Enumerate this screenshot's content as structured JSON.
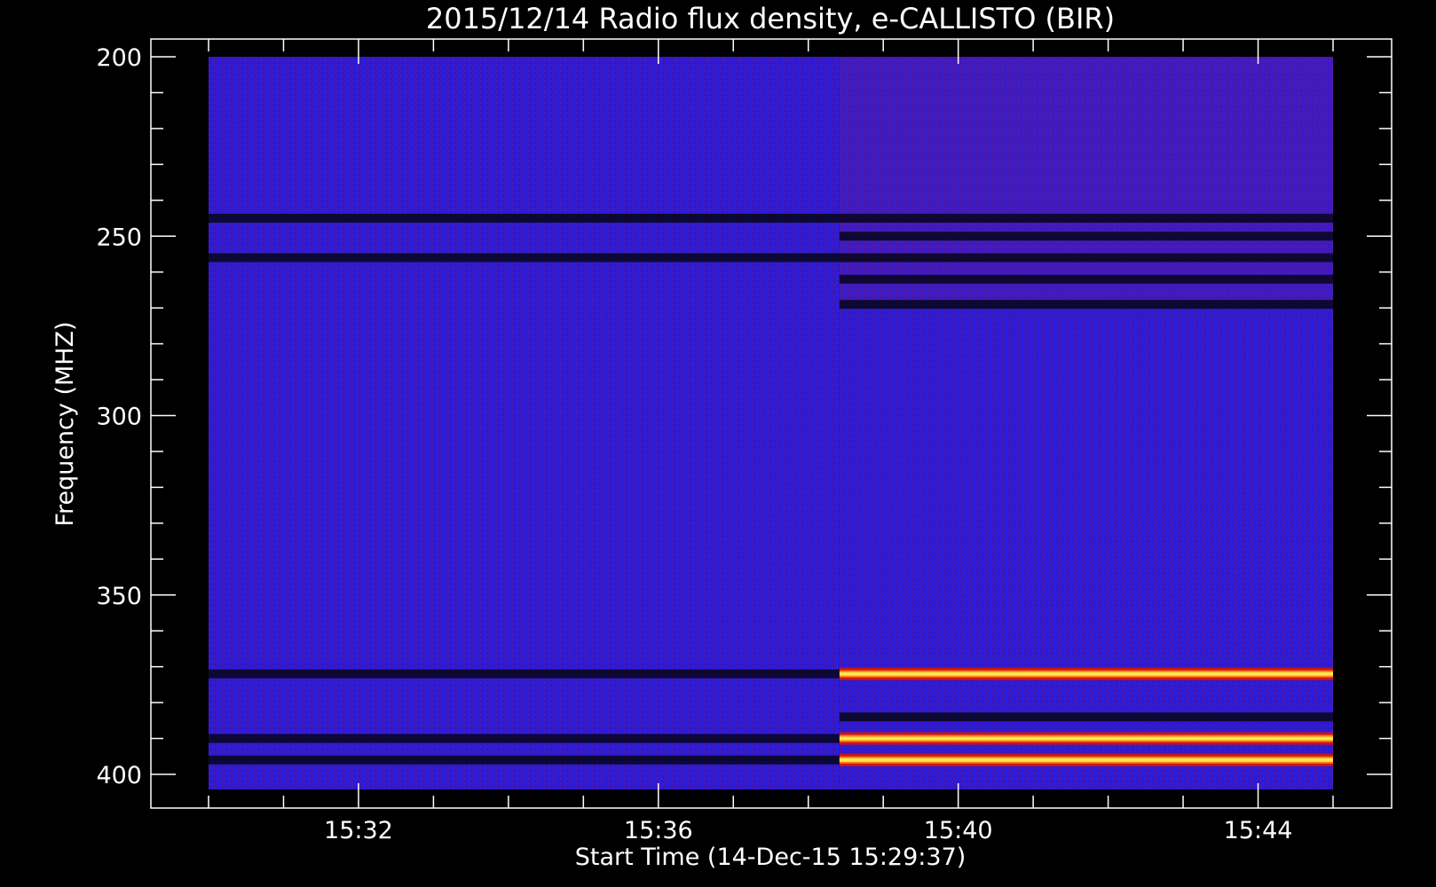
{
  "chart_data": {
    "type": "heatmap",
    "title": "2015/12/14  Radio flux density, e-CALLISTO (BIR)",
    "xlabel": "Start Time (14-Dec-15 15:29:37)",
    "ylabel": "Frequency (MHZ)",
    "x_ticks": [
      "15:32",
      "15:36",
      "15:40",
      "15:44"
    ],
    "y_ticks": [
      "200",
      "250",
      "300",
      "350",
      "400"
    ],
    "xlim": [
      "15:30",
      "15:45"
    ],
    "ylim": [
      200,
      405
    ],
    "y_inverted": true,
    "colormap": "blue-red-yellow",
    "colors": {
      "background": "#000000",
      "axes": "#ffffff",
      "text": "#ffffff",
      "low_flux": "#2b1bd6",
      "noise": "#8a1a6a",
      "high_flux": "#ffe94d",
      "band_dark": "#07051a"
    },
    "segments": [
      {
        "name": "before 15:38:25",
        "start": "15:30:00",
        "end": "15:38:25",
        "level": "low"
      },
      {
        "name": "after 15:38:25",
        "start": "15:38:25",
        "end": "15:45:00",
        "level": "elevated"
      }
    ],
    "bands": [
      {
        "freq_mhz": 245,
        "before": "dark",
        "after": "dark"
      },
      {
        "freq_mhz": 250,
        "before": "none",
        "after": "dark"
      },
      {
        "freq_mhz": 256,
        "before": "dark",
        "after": "dark"
      },
      {
        "freq_mhz": 262,
        "before": "none",
        "after": "dark"
      },
      {
        "freq_mhz": 269,
        "before": "none",
        "after": "dark"
      },
      {
        "freq_mhz": 372,
        "before": "dark",
        "after": "bright"
      },
      {
        "freq_mhz": 384,
        "before": "none",
        "after": "dark"
      },
      {
        "freq_mhz": 390,
        "before": "dark",
        "after": "bright"
      },
      {
        "freq_mhz": 396,
        "before": "dark",
        "after": "bright"
      }
    ]
  }
}
